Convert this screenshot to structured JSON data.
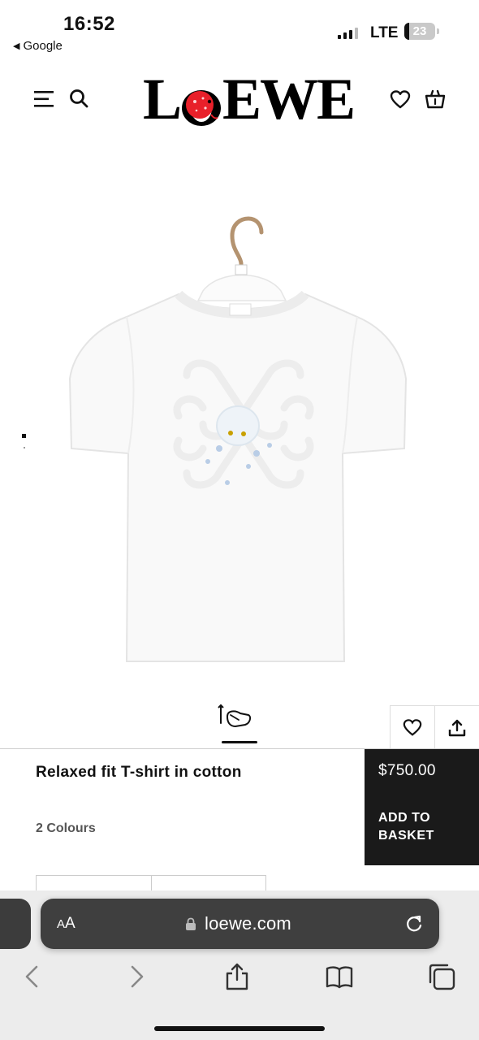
{
  "status_bar": {
    "time": "16:52",
    "back_app": "Google",
    "network": "LTE",
    "battery": "23"
  },
  "header": {
    "brand": "LOEWE",
    "icons": [
      "menu-icon",
      "search-icon",
      "heart-icon",
      "basket-icon"
    ]
  },
  "product": {
    "title": "Relaxed fit T-shirt in cotton",
    "colours": "2 Colours",
    "price": "$750.00",
    "cta": "ADD TO BASKET",
    "image_alt": "white t-shirt on hanger with embossed anagram and octopus"
  },
  "browser": {
    "aa_label": "AA",
    "url": "loewe.com"
  },
  "colors": {
    "panel": "#1a1a1a",
    "address_bar": "#3f3f3f",
    "logo_accent": "#e8202a"
  }
}
